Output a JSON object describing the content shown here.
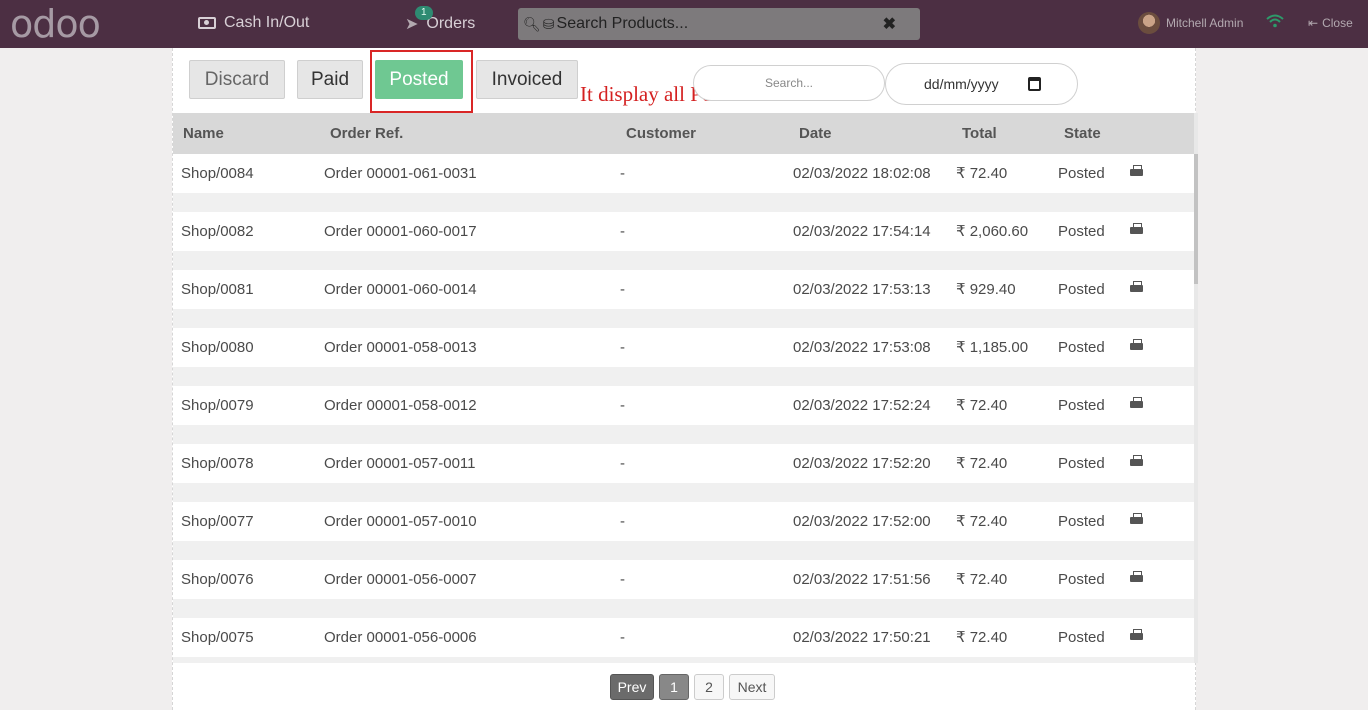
{
  "app": {
    "logo": "odoo"
  },
  "topbar": {
    "cash_label": "Cash In/Out",
    "orders_label": "Orders",
    "orders_badge": "1",
    "search_placeholder": "Search Products...",
    "clear_icon": "close-icon",
    "user_name": "Mitchell Admin",
    "close_label": "Close"
  },
  "filters": {
    "discard": "Discard",
    "paid": "Paid",
    "posted": "Posted",
    "invoiced": "Invoiced",
    "active": "posted",
    "active_color": "#6fc892"
  },
  "annotation": {
    "text": "It display all Posted Orders",
    "color": "#d42020"
  },
  "search": {
    "placeholder": "Search...",
    "date_placeholder": "dd/mm/yyyy"
  },
  "table": {
    "columns": [
      "Name",
      "Order Ref.",
      "Customer",
      "Date",
      "Total",
      "State"
    ],
    "rows": [
      {
        "name": "Shop/0084",
        "ref": "Order 00001-061-0031",
        "customer": "-",
        "date": "02/03/2022 18:02:08",
        "total": "₹ 72.40",
        "state": "Posted"
      },
      {
        "name": "Shop/0082",
        "ref": "Order 00001-060-0017",
        "customer": "-",
        "date": "02/03/2022 17:54:14",
        "total": "₹ 2,060.60",
        "state": "Posted"
      },
      {
        "name": "Shop/0081",
        "ref": "Order 00001-060-0014",
        "customer": "-",
        "date": "02/03/2022 17:53:13",
        "total": "₹ 929.40",
        "state": "Posted"
      },
      {
        "name": "Shop/0080",
        "ref": "Order 00001-058-0013",
        "customer": "-",
        "date": "02/03/2022 17:53:08",
        "total": "₹ 1,185.00",
        "state": "Posted"
      },
      {
        "name": "Shop/0079",
        "ref": "Order 00001-058-0012",
        "customer": "-",
        "date": "02/03/2022 17:52:24",
        "total": "₹ 72.40",
        "state": "Posted"
      },
      {
        "name": "Shop/0078",
        "ref": "Order 00001-057-0011",
        "customer": "-",
        "date": "02/03/2022 17:52:20",
        "total": "₹ 72.40",
        "state": "Posted"
      },
      {
        "name": "Shop/0077",
        "ref": "Order 00001-057-0010",
        "customer": "-",
        "date": "02/03/2022 17:52:00",
        "total": "₹ 72.40",
        "state": "Posted"
      },
      {
        "name": "Shop/0076",
        "ref": "Order 00001-056-0007",
        "customer": "-",
        "date": "02/03/2022 17:51:56",
        "total": "₹ 72.40",
        "state": "Posted"
      },
      {
        "name": "Shop/0075",
        "ref": "Order 00001-056-0006",
        "customer": "-",
        "date": "02/03/2022 17:50:21",
        "total": "₹ 72.40",
        "state": "Posted"
      }
    ],
    "row_action_icon": "print-icon"
  },
  "pagination": {
    "prev": "Prev",
    "pages": [
      "1",
      "2"
    ],
    "current": "1",
    "next": "Next"
  }
}
